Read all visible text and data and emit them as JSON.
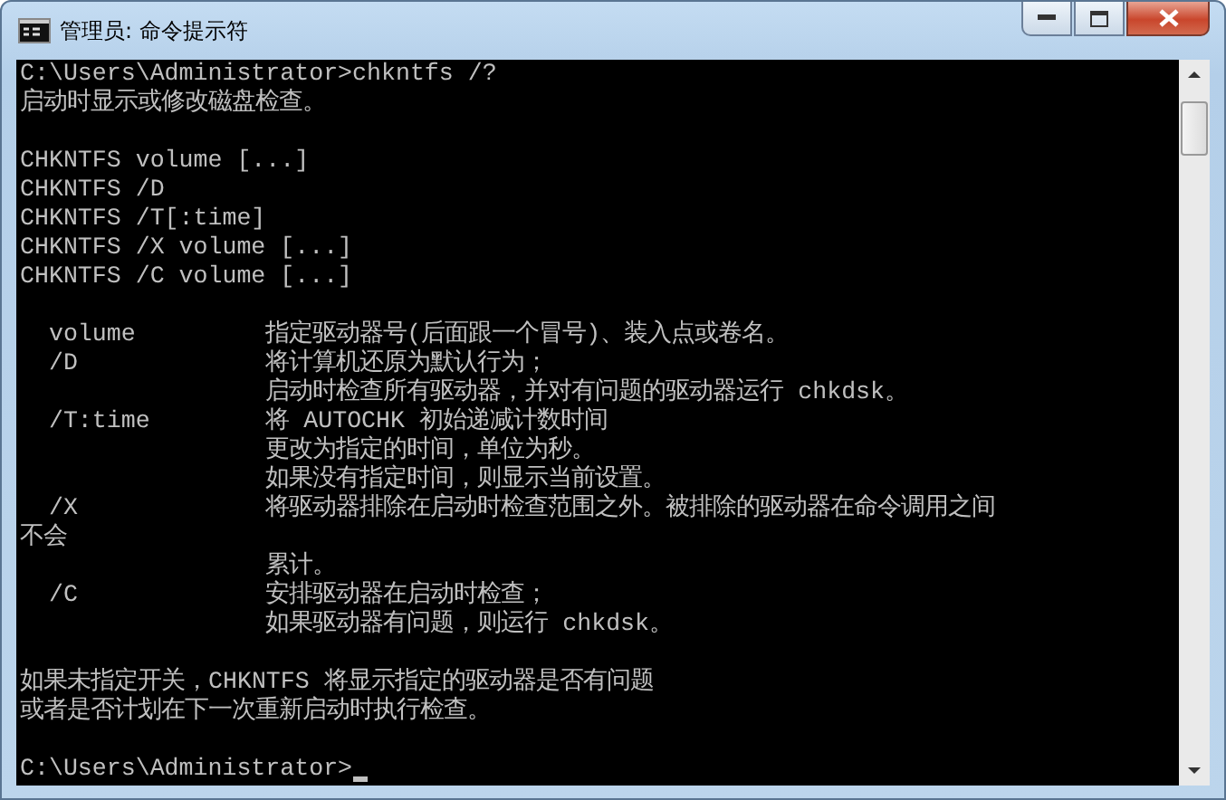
{
  "window": {
    "title": "管理员: 命令提示符"
  },
  "console": {
    "blocks": [
      [
        "C:\\Users\\Administrator>chkntfs /?",
        "启动时显示或修改磁盘检查。"
      ],
      [
        "CHKNTFS volume [...]",
        "CHKNTFS /D",
        "CHKNTFS /T[:time]",
        "CHKNTFS /X volume [...]",
        "CHKNTFS /C volume [...]"
      ],
      [
        "  volume         指定驱动器号(后面跟一个冒号)、装入点或卷名。",
        "  /D             将计算机还原为默认行为；",
        "                 启动时检查所有驱动器，并对有问题的驱动器运行 chkdsk。",
        "  /T:time        将 AUTOCHK 初始递减计数时间",
        "                 更改为指定的时间，单位为秒。",
        "                 如果没有指定时间，则显示当前设置。",
        "  /X             将驱动器排除在启动时检查范围之外。被排除的驱动器在命令调用之间",
        "不会",
        "                 累计。",
        "  /C             安排驱动器在启动时检查；",
        "                 如果驱动器有问题，则运行 chkdsk。"
      ],
      [
        "如果未指定开关，CHKNTFS 将显示指定的驱动器是否有问题",
        "或者是否计划在下一次重新启动时执行检查。"
      ]
    ],
    "prompt": "C:\\Users\\Administrator>"
  }
}
